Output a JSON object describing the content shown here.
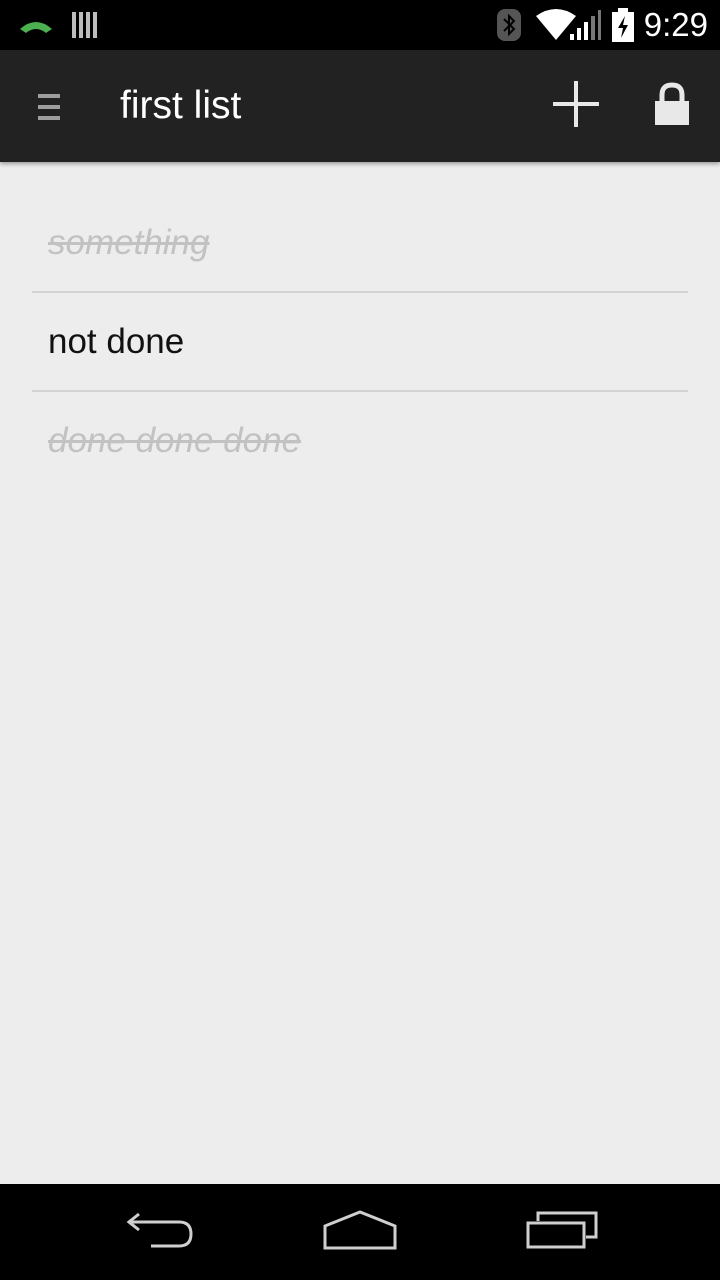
{
  "status_bar": {
    "time": "9:29",
    "icons": [
      "phone-call-icon",
      "barcode-icon",
      "bluetooth-icon",
      "wifi-icon",
      "cell-signal-icon",
      "battery-charging-icon"
    ],
    "call_icon_color": "#4caf50"
  },
  "action_bar": {
    "title": "first list",
    "menu_icon": "drawer-menu-icon",
    "add_icon": "add-icon",
    "lock_icon": "lock-icon",
    "background": "#222222"
  },
  "list": {
    "items": [
      {
        "text": "something",
        "done": true
      },
      {
        "text": "not done",
        "done": false
      },
      {
        "text": "done done done",
        "done": true
      }
    ]
  },
  "nav_bar": {
    "back_icon": "back-icon",
    "home_icon": "home-icon",
    "recents_icon": "recent-apps-icon"
  }
}
